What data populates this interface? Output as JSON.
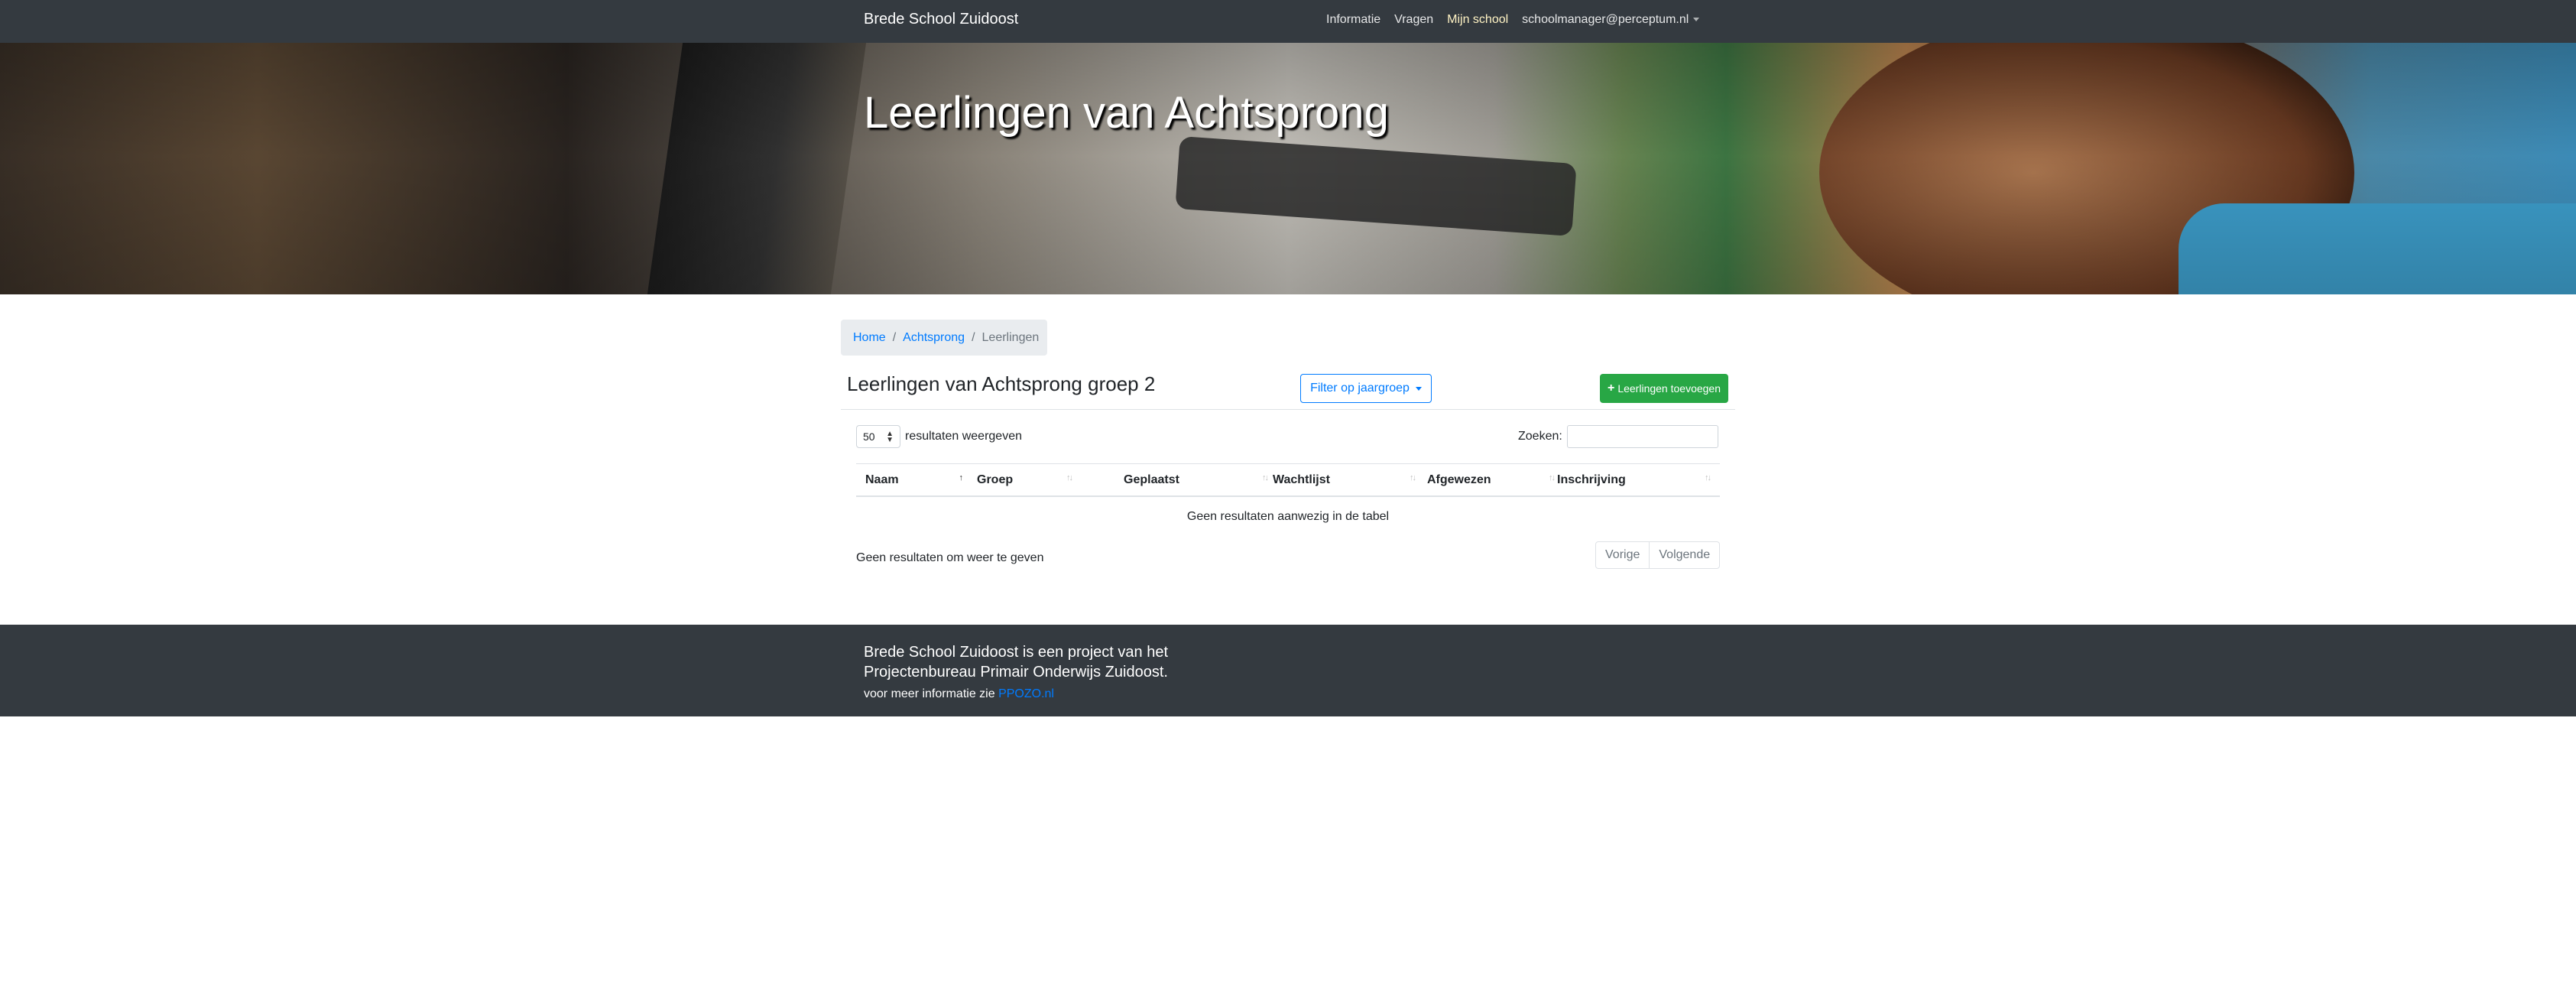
{
  "navbar": {
    "brand": "Brede School Zuidoost",
    "items": [
      {
        "label": "Informatie"
      },
      {
        "label": "Vragen"
      },
      {
        "label": "Mijn school"
      },
      {
        "label": "schoolmanager@perceptum.nl"
      }
    ]
  },
  "hero": {
    "title": "Leerlingen van Achtsprong"
  },
  "breadcrumb": {
    "home": "Home",
    "school": "Achtsprong",
    "current": "Leerlingen"
  },
  "main": {
    "heading": "Leerlingen van Achtsprong groep 2",
    "filter_label": "Filter op jaargroep",
    "add_label": "Leerlingen toevoegen",
    "length": {
      "value": "50",
      "suffix": "resultaten weergeven"
    },
    "search_label": "Zoeken:",
    "columns": [
      "Naam",
      "Groep",
      "Geplaatst",
      "Wachtlijst",
      "Afgewezen",
      "Inschrijving"
    ],
    "empty_text": "Geen resultaten aanwezig in de tabel",
    "info_text": "Geen resultaten om weer te geven",
    "pager": {
      "prev": "Vorige",
      "next": "Volgende"
    }
  },
  "footer": {
    "line1": "Brede School Zuidoost is een project van het Projectenbureau Primair Onderwijs Zuidoost.",
    "line2_prefix": "voor meer informatie zie",
    "link": "PPOZO.nl"
  },
  "colors": {
    "navbar": "#343a40",
    "primary": "#007bff",
    "success": "#28a745",
    "breadcrumb_bg": "#e9ecef"
  },
  "icons": {
    "add": "plus-icon",
    "filter_caret": "caret-down-icon",
    "sort": "sort-icon"
  }
}
